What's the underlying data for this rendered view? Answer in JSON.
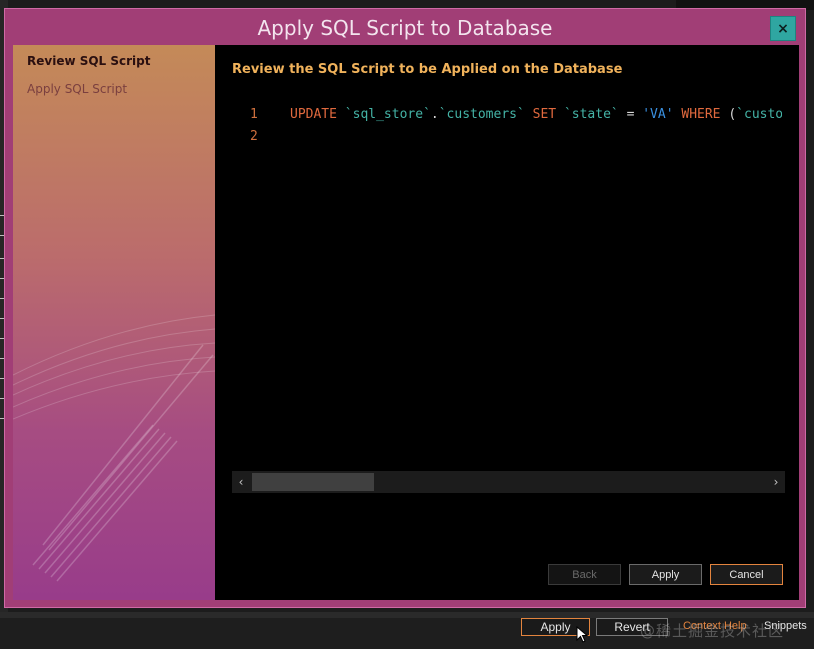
{
  "dialog": {
    "title": "Apply SQL Script to Database",
    "close_label": "×"
  },
  "steps": [
    {
      "label": "Review SQL Script",
      "active": true
    },
    {
      "label": "Apply SQL Script",
      "active": false
    }
  ],
  "content": {
    "heading": "Review the SQL Script to be Applied on the Database"
  },
  "editor": {
    "lines": [
      {
        "number": "1",
        "tokens": [
          {
            "t": "UPDATE",
            "k": "kw"
          },
          {
            "t": " ",
            "k": "pl"
          },
          {
            "t": "`sql_store`",
            "k": "id"
          },
          {
            "t": ".",
            "k": "pl"
          },
          {
            "t": "`customers`",
            "k": "id"
          },
          {
            "t": " ",
            "k": "pl"
          },
          {
            "t": "SET",
            "k": "kw"
          },
          {
            "t": " ",
            "k": "pl"
          },
          {
            "t": "`state`",
            "k": "id"
          },
          {
            "t": " = ",
            "k": "pl"
          },
          {
            "t": "'VA'",
            "k": "str"
          },
          {
            "t": " ",
            "k": "pl"
          },
          {
            "t": "WHERE",
            "k": "kw"
          },
          {
            "t": " (",
            "k": "pl"
          },
          {
            "t": "`custome",
            "k": "id"
          }
        ]
      },
      {
        "number": "2",
        "tokens": []
      }
    ]
  },
  "scrollbar": {
    "left_arrow": "‹",
    "right_arrow": "›"
  },
  "buttons": {
    "back": "Back",
    "apply": "Apply",
    "cancel": "Cancel"
  },
  "background_bar": {
    "apply": "Apply",
    "revert": "Revert",
    "context_help": "Context Help",
    "snippets": "Snippets",
    "watermark": "@稀土掘金技术社区"
  },
  "colors": {
    "dialog_frame": "#a13e76",
    "accent_orange": "#e3843e",
    "close_button": "#2fa6a1",
    "heading": "#f0b25b"
  }
}
